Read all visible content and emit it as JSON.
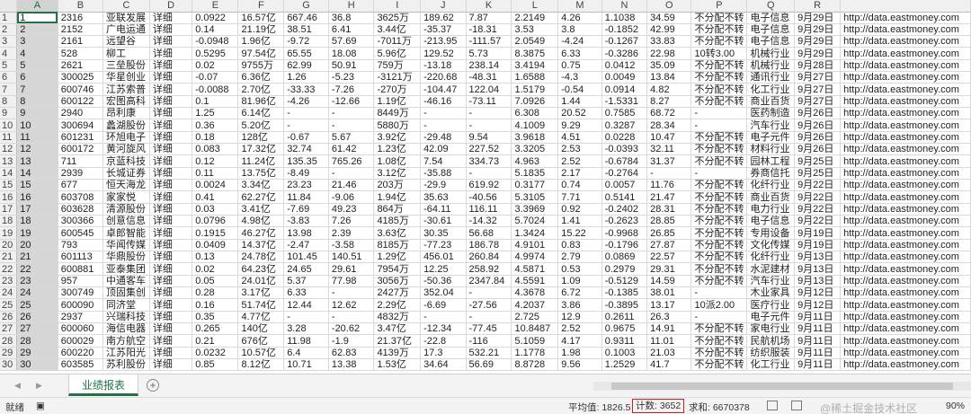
{
  "columns": [
    "A",
    "B",
    "C",
    "D",
    "E",
    "F",
    "G",
    "H",
    "I",
    "J",
    "K",
    "L",
    "M",
    "N",
    "O",
    "P",
    "Q",
    "R"
  ],
  "rows": [
    [
      "1",
      "2316",
      "亚联发展",
      "详细",
      "0.0922",
      "16.57亿",
      "667.46",
      "36.8",
      "3625万",
      "189.62",
      "7.87",
      "2.2149",
      "4.26",
      "1.1038",
      "34.59",
      "不分配不转",
      "电子信息",
      "9月29日",
      "http://data.eastmoney.com"
    ],
    [
      "2",
      "2152",
      "广电运通",
      "详细",
      "0.14",
      "21.19亿",
      "38.51",
      "6.41",
      "3.44亿",
      "-35.37",
      "-18.31",
      "3.53",
      "3.8",
      "-0.1852",
      "42.99",
      "不分配不转",
      "电子信息",
      "9月29日",
      "http://data.eastmoney.com"
    ],
    [
      "3",
      "2161",
      "远望谷",
      "详细",
      "-0.0948",
      "1.96亿",
      "-9.72",
      "57.69",
      "-7011万",
      "-213.95",
      "-111.57",
      "2.0549",
      "-4.24",
      "-0.1267",
      "33.83",
      "不分配不转",
      "电子信息",
      "9月29日",
      "http://data.eastmoney.com"
    ],
    [
      "4",
      "528",
      "柳工",
      "详细",
      "0.5295",
      "97.54亿",
      "65.55",
      "18.08",
      "5.96亿",
      "129.52",
      "5.73",
      "8.3875",
      "6.33",
      "-0.3286",
      "22.98",
      "10转3.00",
      "机械行业",
      "9月29日",
      "http://data.eastmoney.com"
    ],
    [
      "5",
      "2621",
      "三垒股份",
      "详细",
      "0.02",
      "9755万",
      "62.99",
      "50.91",
      "759万",
      "-13.18",
      "238.14",
      "3.4194",
      "0.75",
      "0.0412",
      "35.09",
      "不分配不转",
      "机械行业",
      "9月28日",
      "http://data.eastmoney.com"
    ],
    [
      "6",
      "300025",
      "华星创业",
      "详细",
      "-0.07",
      "6.36亿",
      "1.26",
      "-5.23",
      "-3121万",
      "-220.68",
      "-48.31",
      "1.6588",
      "-4.3",
      "0.0049",
      "13.84",
      "不分配不转",
      "通讯行业",
      "9月27日",
      "http://data.eastmoney.com"
    ],
    [
      "7",
      "600746",
      "江苏索普",
      "详细",
      "-0.0088",
      "2.70亿",
      "-33.33",
      "-7.26",
      "-270万",
      "-104.47",
      "122.04",
      "1.5179",
      "-0.54",
      "0.0914",
      "4.82",
      "不分配不转",
      "化工行业",
      "9月27日",
      "http://data.eastmoney.com"
    ],
    [
      "8",
      "600122",
      "宏图高科",
      "详细",
      "0.1",
      "81.96亿",
      "-4.26",
      "-12.66",
      "1.19亿",
      "-46.16",
      "-73.11",
      "7.0926",
      "1.44",
      "-1.5331",
      "8.27",
      "不分配不转",
      "商业百货",
      "9月27日",
      "http://data.eastmoney.com"
    ],
    [
      "9",
      "2940",
      "昂利康",
      "详细",
      "1.25",
      "6.14亿",
      "-",
      "-",
      "8449万",
      "-",
      "-",
      "6.308",
      "20.52",
      "0.7585",
      "68.72",
      "-",
      "医药制造",
      "9月26日",
      "http://data.eastmoney.com"
    ],
    [
      "10",
      "300694",
      "蠡湖股份",
      "详细",
      "0.36",
      "5.20亿",
      "-",
      "-",
      "5880万",
      "-",
      "-",
      "4.1009",
      "9.29",
      "0.3287",
      "28.34",
      "-",
      "汽车行业",
      "9月26日",
      "http://data.eastmoney.com"
    ],
    [
      "11",
      "601231",
      "环旭电子",
      "详细",
      "0.18",
      "128亿",
      "-0.67",
      "5.67",
      "3.92亿",
      "-29.48",
      "9.54",
      "3.9618",
      "4.51",
      "0.0228",
      "10.47",
      "不分配不转",
      "电子元件",
      "9月26日",
      "http://data.eastmoney.com"
    ],
    [
      "12",
      "600172",
      "黄河旋风",
      "详细",
      "0.083",
      "17.32亿",
      "32.74",
      "61.42",
      "1.23亿",
      "42.09",
      "227.52",
      "3.3205",
      "2.53",
      "-0.0393",
      "32.11",
      "不分配不转",
      "材料行业",
      "9月26日",
      "http://data.eastmoney.com"
    ],
    [
      "13",
      "711",
      "京蓝科技",
      "详细",
      "0.12",
      "11.24亿",
      "135.35",
      "765.26",
      "1.08亿",
      "7.54",
      "334.73",
      "4.963",
      "2.52",
      "-0.6784",
      "31.37",
      "不分配不转",
      "园林工程",
      "9月25日",
      "http://data.eastmoney.com"
    ],
    [
      "14",
      "2939",
      "长城证券",
      "详细",
      "0.11",
      "13.75亿",
      "-8.49",
      "-",
      "3.12亿",
      "-35.88",
      "-",
      "5.1835",
      "2.17",
      "-0.2764",
      "-",
      "-",
      "券商信托",
      "9月25日",
      "http://data.eastmoney.com"
    ],
    [
      "15",
      "677",
      "恒天海龙",
      "详细",
      "0.0024",
      "3.34亿",
      "23.23",
      "21.46",
      "203万",
      "-29.9",
      "619.92",
      "0.3177",
      "0.74",
      "0.0057",
      "11.76",
      "不分配不转",
      "化纤行业",
      "9月22日",
      "http://data.eastmoney.com"
    ],
    [
      "16",
      "603708",
      "家家悦",
      "详细",
      "0.41",
      "62.27亿",
      "11.84",
      "-9.06",
      "1.94亿",
      "35.63",
      "-40.56",
      "5.3105",
      "7.71",
      "0.5141",
      "21.47",
      "不分配不转",
      "商业百货",
      "9月22日",
      "http://data.eastmoney.com"
    ],
    [
      "17",
      "603628",
      "清源股份",
      "详细",
      "0.03",
      "3.41亿",
      "-7.69",
      "49.23",
      "864万",
      "-64.11",
      "116.11",
      "3.3969",
      "0.92",
      "-0.2402",
      "28.31",
      "不分配不转",
      "电力行业",
      "9月22日",
      "http://data.eastmoney.com"
    ],
    [
      "18",
      "300366",
      "创意信息",
      "详细",
      "0.0796",
      "4.98亿",
      "-3.83",
      "7.26",
      "4185万",
      "-30.61",
      "-14.32",
      "5.7024",
      "1.41",
      "-0.2623",
      "28.85",
      "不分配不转",
      "电子信息",
      "9月22日",
      "http://data.eastmoney.com"
    ],
    [
      "19",
      "600545",
      "卓郎智能",
      "详细",
      "0.1915",
      "46.27亿",
      "13.98",
      "2.39",
      "3.63亿",
      "30.35",
      "56.68",
      "1.3424",
      "15.22",
      "-0.9968",
      "26.85",
      "不分配不转",
      "专用设备",
      "9月19日",
      "http://data.eastmoney.com"
    ],
    [
      "20",
      "793",
      "华闻传媒",
      "详细",
      "0.0409",
      "14.37亿",
      "-2.47",
      "-3.58",
      "8185万",
      "-77.23",
      "186.78",
      "4.9101",
      "0.83",
      "-0.1796",
      "27.87",
      "不分配不转",
      "文化传媒",
      "9月19日",
      "http://data.eastmoney.com"
    ],
    [
      "21",
      "601113",
      "华鼎股份",
      "详细",
      "0.13",
      "24.78亿",
      "101.45",
      "140.51",
      "1.29亿",
      "456.01",
      "260.84",
      "4.9974",
      "2.79",
      "0.0869",
      "22.57",
      "不分配不转",
      "化纤行业",
      "9月13日",
      "http://data.eastmoney.com"
    ],
    [
      "22",
      "600881",
      "亚泰集团",
      "详细",
      "0.02",
      "64.23亿",
      "24.65",
      "29.61",
      "7954万",
      "12.25",
      "258.92",
      "4.5871",
      "0.53",
      "0.2979",
      "29.31",
      "不分配不转",
      "水泥建材",
      "9月13日",
      "http://data.eastmoney.com"
    ],
    [
      "23",
      "957",
      "中通客车",
      "详细",
      "0.05",
      "24.01亿",
      "5.37",
      "77.98",
      "3056万",
      "-50.36",
      "2347.84",
      "4.5591",
      "1.09",
      "-0.5129",
      "14.59",
      "不分配不转",
      "汽车行业",
      "9月13日",
      "http://data.eastmoney.com"
    ],
    [
      "24",
      "300749",
      "顶固集创",
      "详细",
      "0.28",
      "3.17亿",
      "6.33",
      "-",
      "2427万",
      "352.04",
      "-",
      "4.3678",
      "6.72",
      "-0.1385",
      "38.01",
      "-",
      "木业家具",
      "9月12日",
      "http://data.eastmoney.com"
    ],
    [
      "25",
      "600090",
      "同济堂",
      "详细",
      "0.16",
      "51.74亿",
      "12.44",
      "12.62",
      "2.29亿",
      "-6.69",
      "-27.56",
      "4.2037",
      "3.86",
      "-0.3895",
      "13.17",
      "10派2.00",
      "医疗行业",
      "9月12日",
      "http://data.eastmoney.com"
    ],
    [
      "26",
      "2937",
      "兴瑞科技",
      "详细",
      "0.35",
      "4.77亿",
      "-",
      "-",
      "4832万",
      "-",
      "-",
      "2.725",
      "12.9",
      "0.2611",
      "26.3",
      "-",
      "电子元件",
      "9月11日",
      "http://data.eastmoney.com"
    ],
    [
      "27",
      "600060",
      "海信电器",
      "详细",
      "0.265",
      "140亿",
      "3.28",
      "-20.62",
      "3.47亿",
      "-12.34",
      "-77.45",
      "10.8487",
      "2.52",
      "0.9675",
      "14.91",
      "不分配不转",
      "家电行业",
      "9月11日",
      "http://data.eastmoney.com"
    ],
    [
      "28",
      "600029",
      "南方航空",
      "详细",
      "0.21",
      "676亿",
      "11.98",
      "-1.9",
      "21.37亿",
      "-22.8",
      "-116",
      "5.1059",
      "4.17",
      "0.9311",
      "11.01",
      "不分配不转",
      "民航机场",
      "9月11日",
      "http://data.eastmoney.com"
    ],
    [
      "29",
      "600220",
      "江苏阳光",
      "详细",
      "0.0232",
      "10.57亿",
      "6.4",
      "62.83",
      "4139万",
      "17.3",
      "532.21",
      "1.1778",
      "1.98",
      "0.1003",
      "21.03",
      "不分配不转",
      "纺织服装",
      "9月11日",
      "http://data.eastmoney.com"
    ],
    [
      "30",
      "603585",
      "苏利股份",
      "详细",
      "0.85",
      "8.12亿",
      "10.71",
      "13.38",
      "1.53亿",
      "34.64",
      "56.69",
      "8.8728",
      "9.56",
      "1.2529",
      "41.7",
      "不分配不转",
      "化工行业",
      "9月11日",
      "http://data.eastmoney.com"
    ]
  ],
  "sheet_tab": "业绩报表",
  "add_sheet": "+",
  "nav_prev": "◀",
  "nav_next": "▶",
  "status": {
    "ready": "就绪",
    "average": "平均值: 1826.5",
    "count": "计数: 3652",
    "sum": "求和: 6670378",
    "zoom": "90%"
  },
  "watermark": "@稀土掘金技术社区",
  "colors": {
    "accent": "#217346",
    "highlight_border": "#d7191c"
  }
}
